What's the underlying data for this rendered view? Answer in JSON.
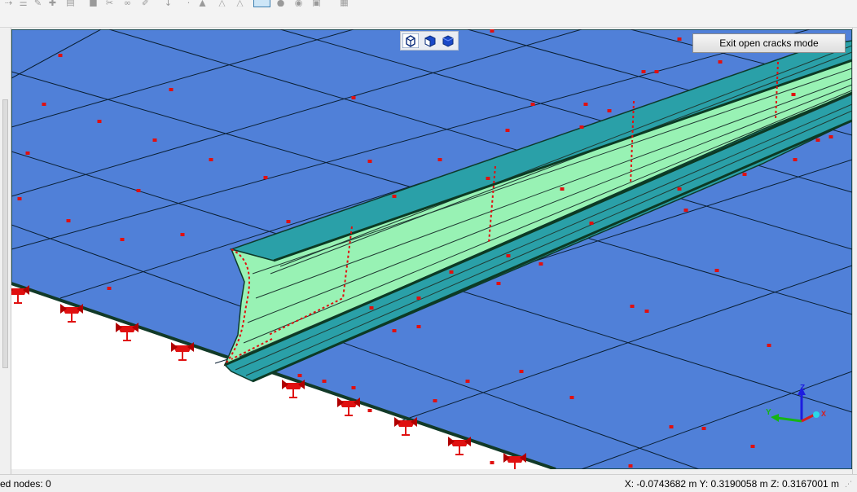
{
  "toolbar": {
    "icons": [
      "select-icon",
      "filter-icon",
      "draw-icon",
      "add-icon",
      "copy-icon",
      "scissors-icon",
      "pen-icon",
      "pin-icon",
      "point-icon",
      "triangle-mesh-icon",
      "triangle-mesh-icon",
      "triangle-icon",
      "cube-view-icon",
      "sphere-icon",
      "shaded-sphere-icon",
      "printer-icon",
      "grid-icon"
    ],
    "active_icon": "cube-view-icon"
  },
  "view_cube": {
    "buttons": [
      "wireframe-cube-icon",
      "half-shaded-cube-icon",
      "shaded-cube-icon"
    ]
  },
  "exit_button": {
    "label": "Exit open cracks mode"
  },
  "triad": {
    "x_label": "X",
    "y_label": "Y",
    "z_label": "Z"
  },
  "status": {
    "left": "ed nodes: 0",
    "coordinates": "X: -0.0743682 m Y: 0.3190058 m Z: 0.3167001 m"
  },
  "colors": {
    "plate": "#5080d8",
    "flange_top": "#2aa0a8",
    "web": "#98f2b4",
    "mesh_line": "#0a1f33",
    "node": "#e01010",
    "support": "#e01010",
    "background": "#ffffff"
  }
}
